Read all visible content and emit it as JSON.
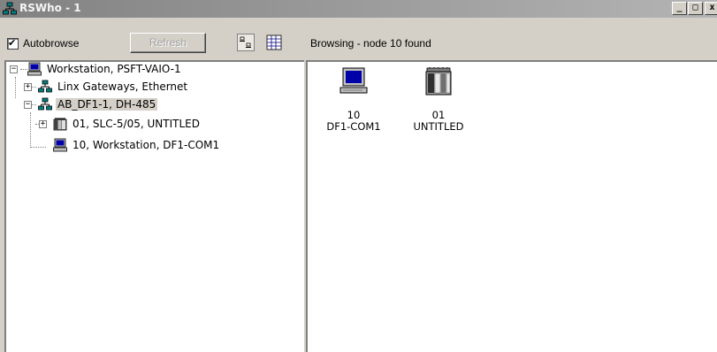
{
  "window": {
    "title": "RSWho - 1",
    "icon": "network-icon"
  },
  "titlebar_buttons": {
    "minimize": "_",
    "maximize": "□",
    "close": "x"
  },
  "toolbar": {
    "autobrowse_label": "Autobrowse",
    "autobrowse_checked": true,
    "refresh_label": "Refresh",
    "status": "Browsing - node 10 found"
  },
  "tree": [
    {
      "label": "Workstation, PSFT-VAIO-1",
      "icon": "computer-icon",
      "expander": "−"
    },
    {
      "label": "Linx Gateways, Ethernet",
      "icon": "network-icon",
      "expander": "+"
    },
    {
      "label": "AB_DF1-1, DH-485",
      "icon": "network-icon",
      "expander": "−"
    },
    {
      "label": "01, SLC-5/05, UNTITLED",
      "icon": "plc-icon",
      "expander": "+"
    },
    {
      "label": "10, Workstation, DF1-COM1",
      "icon": "computer-icon",
      "expander": ""
    }
  ],
  "devices": [
    {
      "line1": "10",
      "line2": "DF1-COM1",
      "icon": "computer-icon"
    },
    {
      "line1": "01",
      "line2": "UNTITLED",
      "icon": "plc-icon"
    }
  ],
  "colors": {
    "titlebar": "#828282",
    "face": "#d4d0c8",
    "screen": "#0000a8"
  }
}
